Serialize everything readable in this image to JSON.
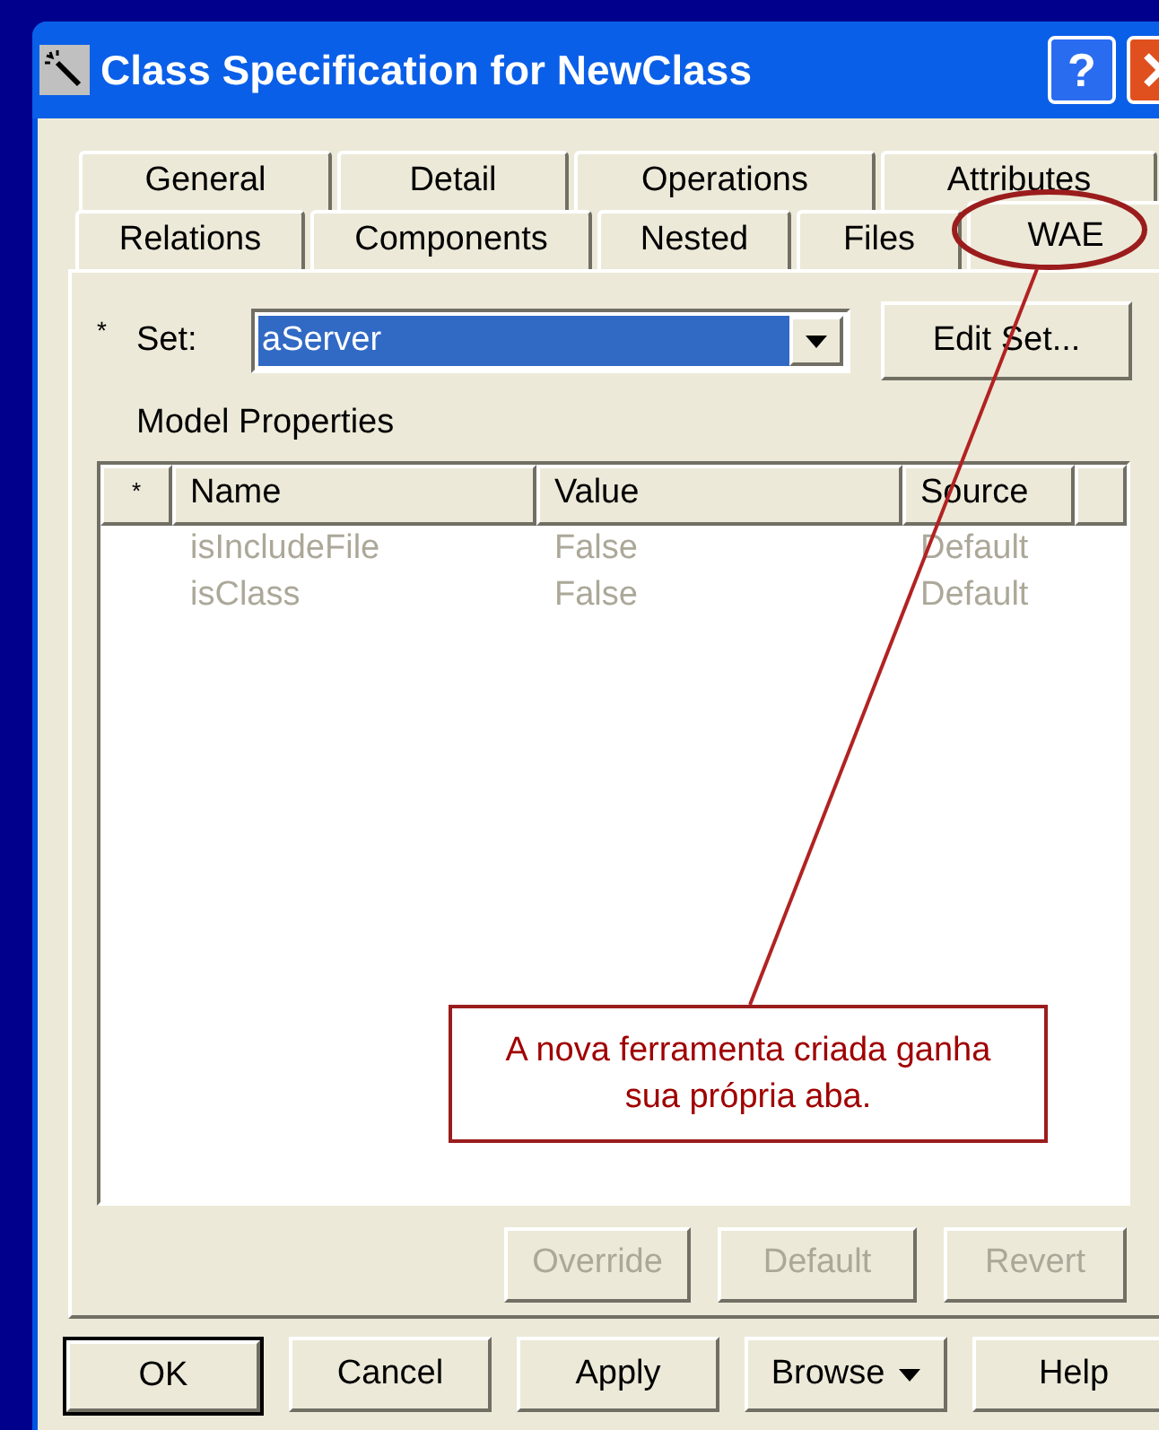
{
  "window": {
    "title": "Class Specification for NewClass",
    "help_glyph": "?"
  },
  "tabs_back": [
    {
      "label": "General",
      "selected": false
    },
    {
      "label": "Detail",
      "selected": false
    },
    {
      "label": "Operations",
      "selected": false
    },
    {
      "label": "Attributes",
      "selected": false
    }
  ],
  "tabs_front": [
    {
      "label": "Relations",
      "selected": false
    },
    {
      "label": "Components",
      "selected": false
    },
    {
      "label": "Nested",
      "selected": false
    },
    {
      "label": "Files",
      "selected": false
    },
    {
      "label": "WAE",
      "selected": true
    }
  ],
  "set": {
    "marker": "*",
    "label": "Set:",
    "value": "aServer"
  },
  "edit_set_button": "Edit Set...",
  "model_properties": {
    "title": "Model Properties",
    "columns": [
      "*",
      "Name",
      "Value",
      "Source"
    ],
    "rows": [
      {
        "name": "isIncludeFile",
        "value": "False",
        "source": "Default",
        "disabled": true
      },
      {
        "name": "isClass",
        "value": "False",
        "source": "Default",
        "disabled": true
      }
    ]
  },
  "property_buttons": [
    {
      "label": "Override",
      "disabled": true
    },
    {
      "label": "Default",
      "disabled": true
    },
    {
      "label": "Revert",
      "disabled": true
    }
  ],
  "buttons": [
    {
      "label": "OK",
      "kind": "default"
    },
    {
      "label": "Cancel",
      "kind": "plain"
    },
    {
      "label": "Apply",
      "kind": "plain"
    },
    {
      "label": "Browse",
      "kind": "menu"
    },
    {
      "label": "Help",
      "kind": "plain"
    }
  ],
  "annotation": {
    "text": "A nova ferramenta criada ganha sua própria aba."
  }
}
